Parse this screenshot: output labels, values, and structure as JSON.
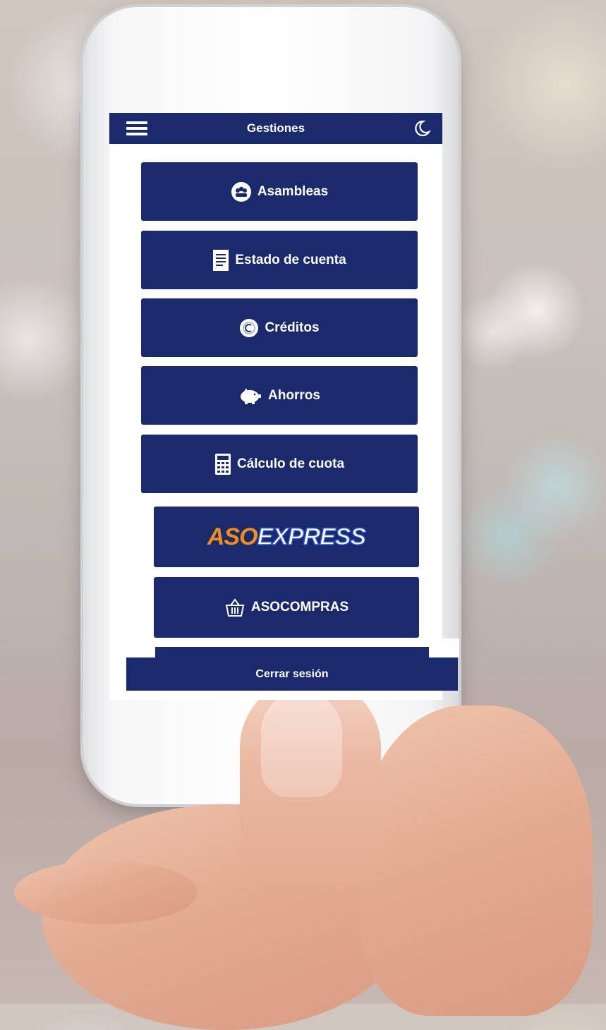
{
  "header": {
    "title": "Gestiones",
    "menu_icon": "hamburger-menu-icon",
    "theme_icon": "moon-icon"
  },
  "menu": {
    "items": [
      {
        "label": "Asambleas",
        "icon": "people-group-icon"
      },
      {
        "label": "Estado de cuenta",
        "icon": "document-icon"
      },
      {
        "label": "Créditos",
        "icon": "currency-coin-icon"
      },
      {
        "label": "Ahorros",
        "icon": "piggy-bank-icon"
      },
      {
        "label": "Cálculo de cuota",
        "icon": "calculator-icon"
      }
    ],
    "asoexpress": {
      "logo_aso": "ASO",
      "logo_express": "EXPRESS"
    },
    "asocompras": {
      "label": "ASOCOMPRAS",
      "icon": "shopping-basket-icon"
    }
  },
  "footer": {
    "logout_label": "Cerrar sesión"
  },
  "colors": {
    "primary": "#1a2a6c",
    "accent": "#f28c1a",
    "text": "#ffffff"
  }
}
